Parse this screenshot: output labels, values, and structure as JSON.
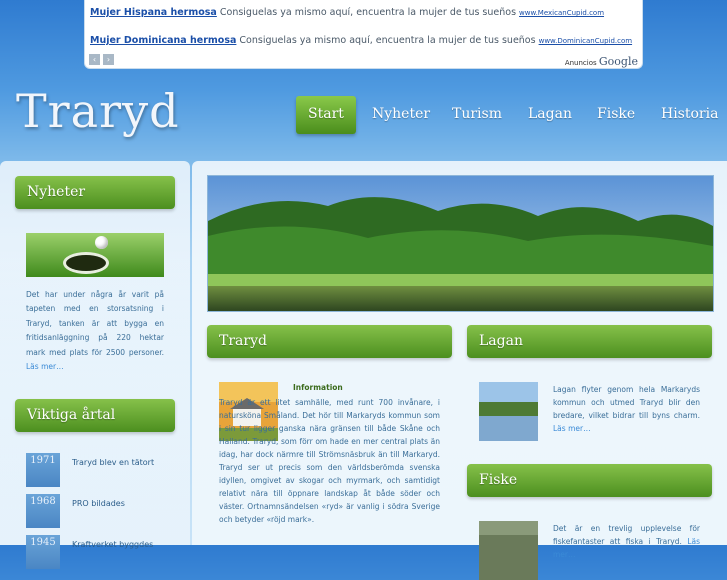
{
  "ads": {
    "items": [
      {
        "title": "Mujer Hispana hermosa",
        "text": " Consiguelas ya mismo aquí, encuentra la mujer de tus sueños ",
        "url": "www.MexicanCupid.com"
      },
      {
        "title": "Mujer Dominicana hermosa",
        "text": " Consiguelas ya mismo aquí, encuentra la mujer de tus sueños ",
        "url": "www.DominicanCupid.com"
      }
    ],
    "prev": "‹",
    "next": "›",
    "label": "Anuncios",
    "google": "Google"
  },
  "site": {
    "logo": "Traryd"
  },
  "nav": [
    {
      "label": "Start",
      "active": true
    },
    {
      "label": "Nyheter"
    },
    {
      "label": "Turism"
    },
    {
      "label": "Lagan"
    },
    {
      "label": "Fiske"
    },
    {
      "label": "Historia"
    }
  ],
  "sidebar": {
    "news_heading": "Nyheter",
    "news_text": "Det har under några år varit på tapeten med en storsatsning i Traryd, tanken är att bygga en fritidsanläggning på 220 hektar mark med plats för 2500 personer. ",
    "news_more": "Läs mer…",
    "years_heading": "Viktiga årtal",
    "years": [
      {
        "year": "1971",
        "text": "Traryd blev en tätort"
      },
      {
        "year": "1968",
        "text": "PRO bildades"
      },
      {
        "year": "1945",
        "text": "Kraftverket byggdes"
      }
    ]
  },
  "main": {
    "traryd_heading": "Traryd",
    "info_label": "Information",
    "traryd_text": "Traryd är ett litet samhälle, med runt 700 invånare, i natursköna Småland. Det hör till Markaryds kommun som i sin tur ligger ganska nära gränsen till både Skåne och Halland. Traryd, som förr om hade en mer central plats än idag, har dock närmre till Strömsnäsbruk än till Markaryd. Traryd ser ut precis som den världsberömda svenska idyllen, omgivet av skogar och myrmark, och samtidigt relativt nära till öppnare landskap åt både söder och väster. Ortnamnsändelsen «ryd» är vanlig i södra Sverige och betyder «röjd mark».",
    "lagan_heading": "Lagan",
    "lagan_text": "Lagan flyter genom hela Markaryds kommun och utmed Traryd blir den bredare, vilket bidrar till byns charm. ",
    "lagan_more": "Läs mer…",
    "fiske_heading": "Fiske",
    "fiske_text": "Det är en trevlig upplevelse för fiskefantaster att fiska i Traryd. ",
    "fiske_more": "Läs mer…"
  }
}
